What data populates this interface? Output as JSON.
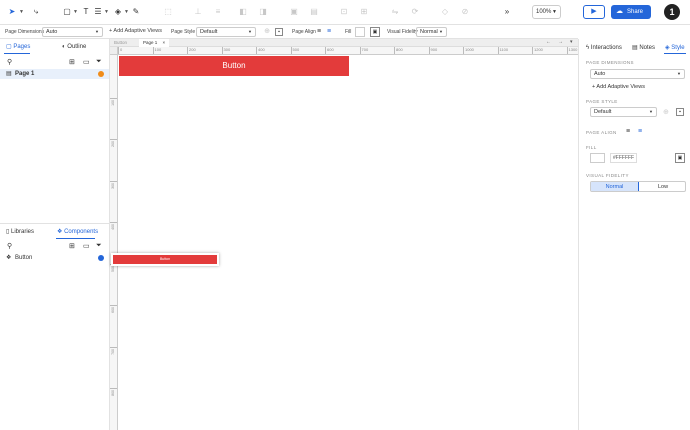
{
  "toolbar": {
    "zoom": "100%",
    "share_label": "Share",
    "avatar_initial": "1"
  },
  "props": {
    "page_dimensions_label": "Page Dimensions",
    "page_dimensions_value": "Auto",
    "add_adaptive_views": "+ Add Adaptive Views",
    "page_style_label": "Page Style",
    "page_style_value": "Default",
    "page_align_label": "Page Align",
    "fill_label": "Fill",
    "visual_fidelity_label": "Visual Fidelity",
    "visual_fidelity_value": "Normal"
  },
  "left": {
    "tabs": [
      "Pages",
      "Outline"
    ],
    "pages": [
      "Page 1"
    ],
    "bottom_tabs": [
      "Libraries",
      "Components"
    ],
    "components": [
      "Button"
    ]
  },
  "doc_tabs": [
    "Button",
    "Page 1"
  ],
  "ruler": {
    "h": [
      "0",
      "100",
      "200",
      "300",
      "400",
      "500",
      "600",
      "700",
      "800",
      "900",
      "1000",
      "1100",
      "1200",
      "1300"
    ],
    "v": [
      "100",
      "200",
      "300",
      "400",
      "500",
      "600",
      "700",
      "800",
      "900"
    ]
  },
  "canvas": {
    "button_label": "Button",
    "component_preview_label": "Button"
  },
  "right": {
    "tabs": [
      "Interactions",
      "Notes",
      "Style"
    ],
    "page_dimensions_title": "PAGE DIMENSIONS",
    "page_dimensions_value": "Auto",
    "add_adaptive_views": "+ Add Adaptive Views",
    "page_style_title": "PAGE STYLE",
    "page_style_value": "Default",
    "page_align_title": "PAGE ALIGN",
    "fill_title": "FILL",
    "fill_hex": "#FFFFFF",
    "visual_fidelity_title": "VISUAL FIDELITY",
    "fidelity_options": [
      "Normal",
      "Low"
    ]
  },
  "colors": {
    "accent": "#2466d9",
    "button_red": "#e33b3b",
    "badge_orange": "#f08c1a"
  }
}
